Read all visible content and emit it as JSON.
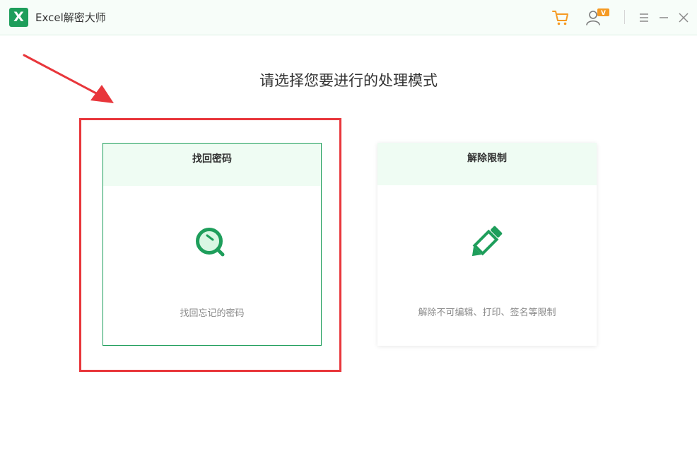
{
  "app": {
    "title": "Excel解密大师",
    "logo_letter": "X"
  },
  "titlebar": {
    "icons": [
      "cart-icon",
      "user-vip-icon",
      "menu-icon",
      "minimize-icon",
      "close-icon"
    ],
    "vip_badge": "V"
  },
  "main": {
    "prompt": "请选择您要进行的处理模式",
    "cards": [
      {
        "title": "找回密码",
        "description": "找回忘记的密码",
        "icon": "search-icon"
      },
      {
        "title": "解除限制",
        "description": "解除不可编辑、打印、签名等限制",
        "icon": "pencil-icon"
      }
    ]
  },
  "colors": {
    "brand_green": "#1e9e5b",
    "card_header_bg": "#effcf3",
    "annotation_red": "#e8363b",
    "cart_orange": "#f59a23"
  }
}
